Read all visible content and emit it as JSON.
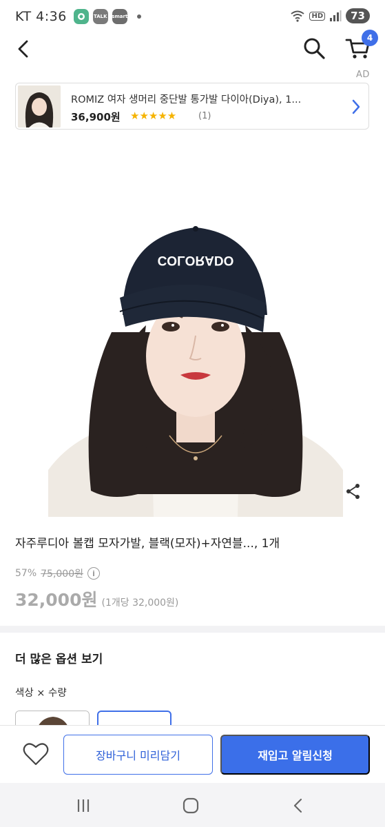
{
  "status_bar": {
    "carrier_time": "KT 4:36",
    "notif_talk": "TALK",
    "notif_smart": "smart",
    "hd": "HD",
    "battery": "73"
  },
  "nav": {
    "cart_count": "4",
    "ad_label": "AD"
  },
  "ad": {
    "title": "ROMIZ 여자 생머리 중단발 통가발 다이아(Diya), 1...",
    "price": "36,900원",
    "stars": "★★★★★",
    "reviews": "(1)"
  },
  "product": {
    "title": "자주루디아 볼캡 모자가발, 블랙(모자)+자연블..., 1개",
    "discount": "57%",
    "original_price": "75,000원",
    "info_icon": "i",
    "sale_price": "32,000원",
    "unit_price": "(1개당 32,000원)",
    "cap_text": "COLORADO"
  },
  "options": {
    "heading": "더 많은 옵션 보기",
    "label": "색상 × 수량"
  },
  "actions": {
    "cart_preview": "장바구니 미리담기",
    "restock": "재입고 알림신청"
  },
  "colors": {
    "accent": "#3b6fe9",
    "cap": "#1c2434"
  }
}
